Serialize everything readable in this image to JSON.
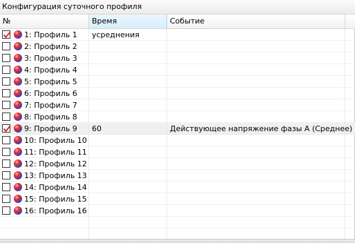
{
  "window": {
    "title": "Конфигурация суточного профиля"
  },
  "columns": {
    "number": "№",
    "averaging_time": "Время усреднения",
    "event": "Событие"
  },
  "rows": [
    {
      "label": "1: Профиль 1",
      "checked": true,
      "time": "",
      "event": ""
    },
    {
      "label": "2: Профиль 2",
      "checked": false,
      "time": "",
      "event": ""
    },
    {
      "label": "3: Профиль 3",
      "checked": false,
      "time": "",
      "event": ""
    },
    {
      "label": "4: Профиль 4",
      "checked": false,
      "time": "",
      "event": ""
    },
    {
      "label": "5: Профиль 5",
      "checked": false,
      "time": "",
      "event": ""
    },
    {
      "label": "6: Профиль 6",
      "checked": false,
      "time": "",
      "event": ""
    },
    {
      "label": "7: Профиль 7",
      "checked": false,
      "time": "",
      "event": ""
    },
    {
      "label": "8: Профиль 8",
      "checked": false,
      "time": "",
      "event": ""
    },
    {
      "label": "9: Профиль 9",
      "checked": true,
      "time": "60",
      "event": "Действующее напряжение фазы A (Среднее)"
    },
    {
      "label": "10: Профиль 10",
      "checked": false,
      "time": "",
      "event": ""
    },
    {
      "label": "11: Профиль 11",
      "checked": false,
      "time": "",
      "event": ""
    },
    {
      "label": "12: Профиль 12",
      "checked": false,
      "time": "",
      "event": ""
    },
    {
      "label": "13: Профиль 13",
      "checked": false,
      "time": "",
      "event": ""
    },
    {
      "label": "14: Профиль 14",
      "checked": false,
      "time": "",
      "event": ""
    },
    {
      "label": "15: Профиль 15",
      "checked": false,
      "time": "",
      "event": ""
    },
    {
      "label": "16: Профиль 16",
      "checked": false,
      "time": "",
      "event": ""
    }
  ],
  "selected_row": 9,
  "icons": {
    "row_status": "profile-orb-icon",
    "check": "checkmark-icon"
  },
  "colors": {
    "check": "#d42020",
    "selected_row": "#f0f0f0",
    "sorted_header": "#d7effc"
  }
}
